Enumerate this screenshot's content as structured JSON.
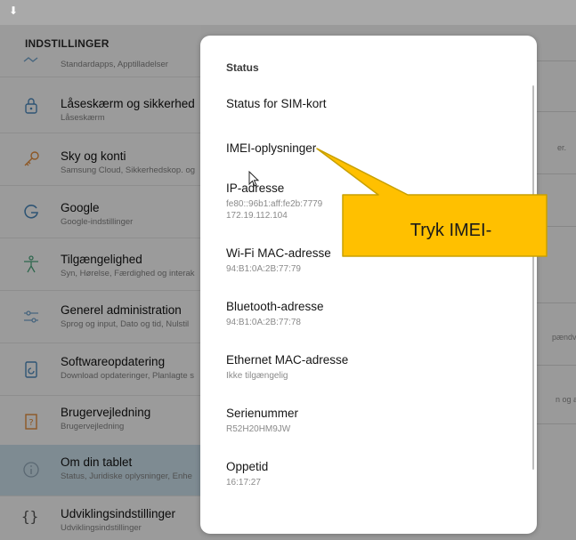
{
  "settings": {
    "header": "INDSTILLINGER",
    "items": [
      {
        "title": "",
        "subtitle": "Standardapps, Apptilladelser",
        "icon": "apps-icon"
      },
      {
        "title": "Låseskærm og sikkerhed",
        "subtitle": "Låseskærm",
        "icon": "lock-icon"
      },
      {
        "title": "Sky og konti",
        "subtitle": "Samsung Cloud, Sikkerhedskop. og",
        "icon": "key-icon"
      },
      {
        "title": "Google",
        "subtitle": "Google-indstillinger",
        "icon": "google-icon"
      },
      {
        "title": "Tilgængelighed",
        "subtitle": "Syn, Hørelse, Færdighed og interak",
        "icon": "accessibility-icon"
      },
      {
        "title": "Generel administration",
        "subtitle": "Sprog og input, Dato og tid, Nulstil",
        "icon": "sliders-icon"
      },
      {
        "title": "Softwareopdatering",
        "subtitle": "Download opdateringer, Planlagte s",
        "icon": "software-update-icon"
      },
      {
        "title": "Brugervejledning",
        "subtitle": "Brugervejledning",
        "icon": "manual-icon"
      },
      {
        "title": "Om din tablet",
        "subtitle": "Status, Juridiske oplysninger, Enhe",
        "icon": "info-icon"
      },
      {
        "title": "Udviklingsindstillinger",
        "subtitle": "Udviklingsindstillinger",
        "icon": "braces-icon"
      }
    ]
  },
  "right_pane": {
    "fragments": [
      "er.",
      "pændversic",
      "n og andre"
    ]
  },
  "dialog": {
    "title": "Status",
    "items": [
      {
        "label": "Status for SIM-kort",
        "value": ""
      },
      {
        "label": "IMEI-oplysninger",
        "value": ""
      },
      {
        "label": "IP-adresse",
        "value": "fe80::96b1:aff:fe2b:7779",
        "value2": "172.19.112.104"
      },
      {
        "label": "Wi-Fi MAC-adresse",
        "value": "94:B1:0A:2B:77:79"
      },
      {
        "label": "Bluetooth-adresse",
        "value": "94:B1:0A:2B:77:78"
      },
      {
        "label": "Ethernet MAC-adresse",
        "value": "Ikke tilgængelig"
      },
      {
        "label": "Serienummer",
        "value": "R52H20HM9JW"
      },
      {
        "label": "Oppetid",
        "value": "16:17:27"
      }
    ]
  },
  "callout": {
    "text": "Tryk IMEI-",
    "fill": "#ffc000",
    "border": "#c8a000"
  },
  "colors": {
    "active_row": "#c8dce7",
    "icon_blue": "#4a86b8",
    "icon_orange": "#e08a3c"
  }
}
